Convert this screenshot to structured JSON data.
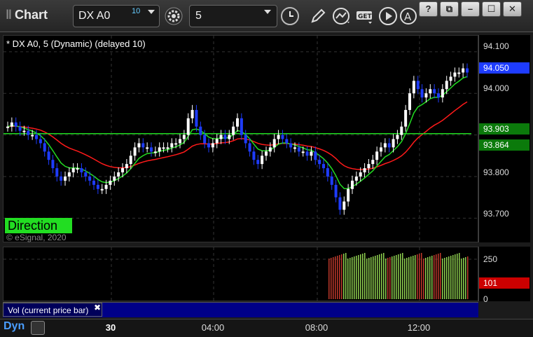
{
  "window": {
    "title": "Chart",
    "symbol_value": "DX A0",
    "symbol_superscript": "10",
    "interval_value": "5",
    "buttons": {
      "help": "?",
      "restore": "⧉",
      "minimize": "–",
      "maximize": "☐",
      "close": "✕"
    }
  },
  "legend": "* DX A0, 5 (Dynamic) (delayed 10)",
  "watermark": "© eSignal, 2020",
  "direction_label": "Direction",
  "price_scale": {
    "labels": [
      "94.100",
      "94.000",
      "93.800",
      "93.700"
    ],
    "badges": [
      {
        "value": "94.050",
        "color": "#1e3cff"
      },
      {
        "value": "93.903",
        "color": "#0b7a0b"
      },
      {
        "value": "93.864",
        "color": "#0b7a0b"
      }
    ]
  },
  "volume": {
    "label": "Vol (current price bar)",
    "scale_labels": [
      "250",
      "0"
    ],
    "badge": "101",
    "badge_color": "#cc0000"
  },
  "time_axis": {
    "mode": "Dyn",
    "labels": [
      "30",
      "04:00",
      "08:00",
      "12:00"
    ]
  },
  "colors": {
    "up": "#ffffff",
    "down": "#1e3cff",
    "red_line": "#ff1a1a",
    "green_line": "#22dd22"
  },
  "chart_data": {
    "type": "candlestick",
    "ylim": [
      93.65,
      94.13
    ],
    "close_series": [
      93.92,
      93.93,
      93.92,
      93.91,
      93.91,
      93.9,
      93.9,
      93.89,
      93.88,
      93.86,
      93.84,
      93.82,
      93.8,
      93.79,
      93.8,
      93.81,
      93.82,
      93.82,
      93.81,
      93.8,
      93.79,
      93.78,
      93.77,
      93.77,
      93.78,
      93.79,
      93.8,
      93.81,
      93.82,
      93.83,
      93.85,
      93.87,
      93.88,
      93.87,
      93.87,
      93.86,
      93.86,
      93.87,
      93.87,
      93.87,
      93.88,
      93.88,
      93.89,
      93.9,
      93.94,
      93.96,
      93.92,
      93.9,
      93.88,
      93.87,
      93.88,
      93.89,
      93.9,
      93.89,
      93.9,
      93.92,
      93.94,
      93.9,
      93.88,
      93.86,
      93.84,
      93.83,
      93.85,
      93.86,
      93.87,
      93.89,
      93.9,
      93.89,
      93.88,
      93.87,
      93.87,
      93.86,
      93.86,
      93.85,
      93.86,
      93.84,
      93.83,
      93.82,
      93.8,
      93.78,
      93.75,
      93.72,
      93.74,
      93.77,
      93.79,
      93.8,
      93.81,
      93.82,
      93.83,
      93.84,
      93.86,
      93.87,
      93.88,
      93.87,
      93.89,
      93.9,
      93.92,
      93.96,
      94.0,
      94.03,
      94.01,
      93.99,
      94.0,
      94.01,
      94.0,
      93.99,
      94.01,
      94.03,
      94.04,
      94.05,
      94.05,
      94.06,
      94.05
    ]
  }
}
